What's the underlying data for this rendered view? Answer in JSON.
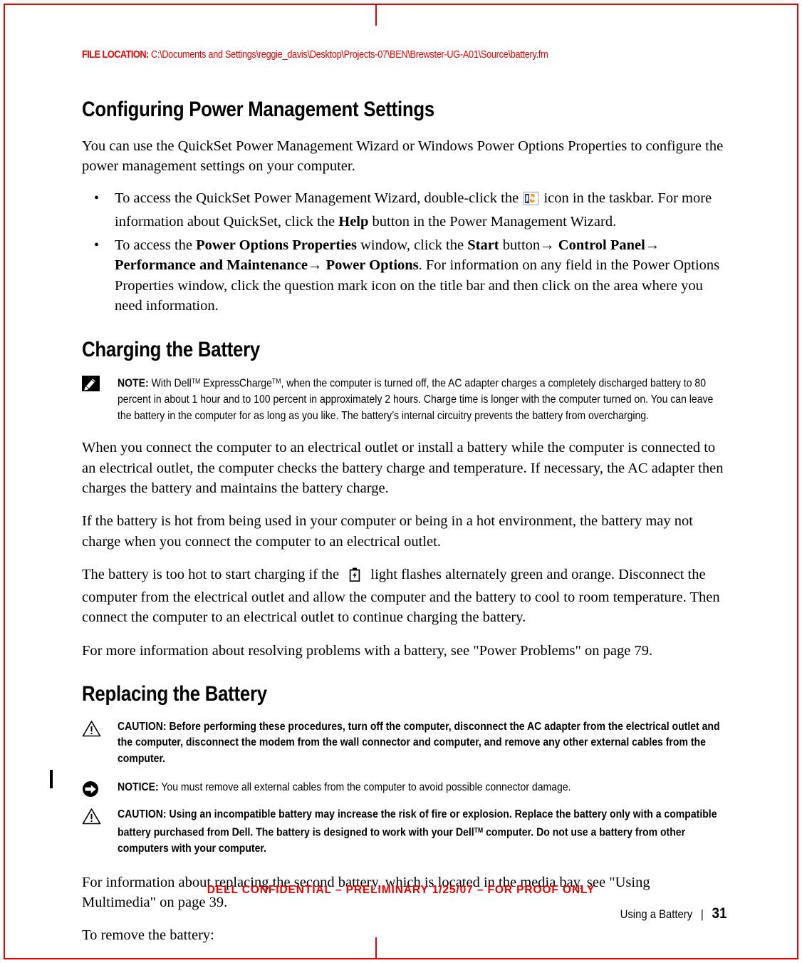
{
  "header": {
    "file_location_label": "FILE LOCATION:",
    "file_location_path": "C:\\Documents and Settings\\reggie_davis\\Desktop\\Projects-07\\BEN\\Brewster-UG-A01\\Source\\battery.fm",
    "accent_color": "#ee0000"
  },
  "sections": {
    "power_mgmt": {
      "heading": "Configuring Power Management Settings",
      "intro": "You can use the QuickSet Power Management Wizard or Windows Power Options Properties to configure the power management settings on your computer.",
      "bullet1": {
        "pre_icon": "To access the QuickSet Power Management Wizard, double-click the",
        "post_icon_a": "icon in the taskbar. For more information about QuickSet, click the",
        "bold_help": "Help",
        "post_icon_b": "button in the Power Management Wizard."
      },
      "bullet2": {
        "t1": "To access the ",
        "b1": "Power Options Properties",
        "t2": " window, click the ",
        "b2": "Start",
        "t3": " button",
        "arrow1": "→",
        "b3": " Control Panel",
        "arrow2": "→",
        "b4": "Performance and Maintenance",
        "arrow3": "→",
        "b5": " Power Options",
        "t4": ". For information on any field in the Power Options Properties window, click the question mark icon on the title bar and then click on the area where you need information."
      }
    },
    "charging": {
      "heading": "Charging the Battery",
      "note": {
        "label": "NOTE:",
        "text_a": "With Dell",
        "tm1": "TM",
        "text_b": " ExpressCharge",
        "tm2": "TM",
        "text_c": ", when the computer is turned off, the AC adapter charges a completely discharged battery to 80 percent in about 1 hour and to 100 percent in approximately 2 hours. Charge time is longer with the computer turned on. You can leave the battery in the computer for as long as you like. The battery’s internal circuitry prevents the battery from overcharging."
      },
      "para1": "When you connect the computer to an electrical outlet or install a battery while the computer is connected to an electrical outlet, the computer checks the battery charge and temperature. If necessary, the AC adapter then charges the battery and maintains the battery charge.",
      "para2": "If the battery is hot from being used in your computer or being in a hot environment, the battery may not charge when you connect the computer to an electrical outlet.",
      "para3_pre": "The battery is too hot to start charging if the",
      "para3_post": "light flashes alternately green and orange. Disconnect the computer from the electrical outlet and allow the computer and the battery to cool to room temperature. Then connect the computer to an electrical outlet to continue charging the battery.",
      "para4": "For more information about resolving problems with a battery, see \"Power Problems\" on page 79."
    },
    "replacing": {
      "heading": "Replacing the Battery",
      "caution1": {
        "label": "CAUTION:",
        "text": "Before performing these procedures, turn off the computer, disconnect the AC adapter from the electrical outlet and the computer, disconnect the modem from the wall connector and computer, and remove any other external cables from the computer."
      },
      "notice1": {
        "label": "NOTICE:",
        "text": "You must remove all external cables from the computer to avoid possible connector damage."
      },
      "caution2": {
        "label": "CAUTION:",
        "text_a": "Using an incompatible battery may increase the risk of fire or explosion. Replace the battery only with a compatible battery purchased from Dell. The battery is designed to work with your Dell",
        "tm1": "TM",
        "text_b": " computer. Do not use a battery from other computers with your computer."
      },
      "para1": "For information about replacing the second battery, which is located in the media bay, see \"Using Multimedia\" on page 39.",
      "para2": "To remove the battery:"
    }
  },
  "icons": {
    "quickset": "quickset-icon",
    "battery_light": "battery-light-icon",
    "note": "note-pencil-icon",
    "caution": "caution-triangle-icon",
    "notice": "notice-arrow-icon"
  },
  "footer": {
    "confidential": "DELL CONFIDENTIAL – PRELIMINARY 1/25/07 – FOR PROOF ONLY",
    "chapter": "Using a Battery",
    "separator": "|",
    "page_number": "31"
  }
}
